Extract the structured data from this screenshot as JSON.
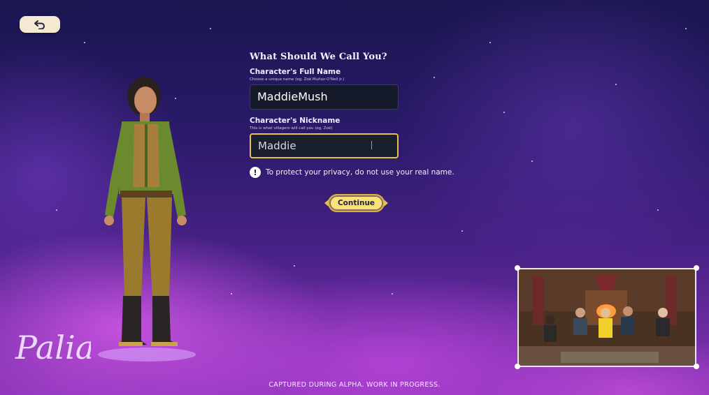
{
  "back_button": {
    "icon": "undo-arrow-icon"
  },
  "form": {
    "title": "What Should We Call You?",
    "full_name": {
      "label": "Character's Full Name",
      "hint": "Choose a unique name (eg. Zoë Muñoz-O'Neil Jr.)",
      "value": "MaddieMush"
    },
    "nickname": {
      "label": "Character's Nickname",
      "hint": "This is what villagers will call you (eg. Zoë)",
      "value": "Maddie"
    },
    "privacy_notice": "To protect your privacy, do not use your real name.",
    "continue_label": "Continue"
  },
  "logo_text": "Palia",
  "footer": "CAPTURED DURING ALPHA. WORK IN PROGRESS.",
  "colors": {
    "accent_gold": "#e6c24a",
    "button_fill": "#f7e37a",
    "input_bg": "#141a2a"
  }
}
